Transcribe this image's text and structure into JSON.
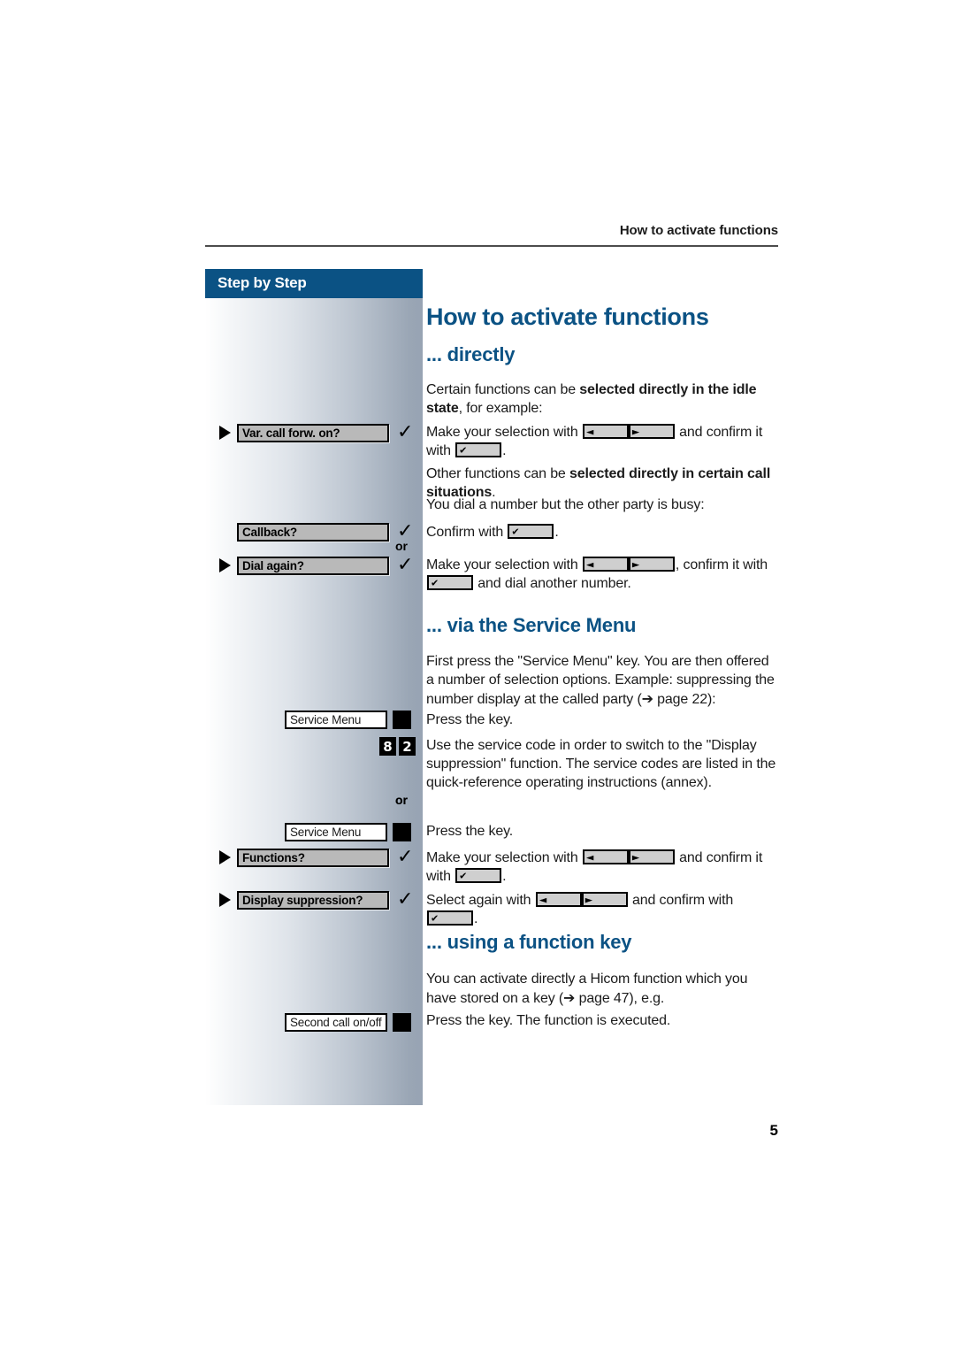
{
  "header": {
    "running_head": "How to activate functions"
  },
  "sidebar": {
    "tab_label": "Step by Step",
    "or_label": "or",
    "rows": [
      {
        "id": "var-call-forw-on",
        "type": "display",
        "arrow": true,
        "label": "Var. call forw. on?",
        "check": true
      },
      {
        "id": "callback",
        "type": "display",
        "arrow": false,
        "label": "Callback?",
        "check": true
      },
      {
        "id": "dial-again",
        "type": "display",
        "arrow": true,
        "label": "Dial again?",
        "check": true
      },
      {
        "id": "service-menu-1",
        "type": "key",
        "arrow": false,
        "label": "Service Menu",
        "check": false
      },
      {
        "id": "service-menu-2",
        "type": "key",
        "arrow": false,
        "label": "Service Menu",
        "check": false
      },
      {
        "id": "functions",
        "type": "display",
        "arrow": true,
        "label": "Functions?",
        "check": true
      },
      {
        "id": "display-suppression",
        "type": "display",
        "arrow": true,
        "label": "Display suppression?",
        "check": true
      },
      {
        "id": "second-call",
        "type": "key",
        "arrow": false,
        "label": "Second call on/off",
        "check": false
      }
    ],
    "service_code": {
      "digits": [
        "8",
        "2"
      ]
    }
  },
  "main": {
    "title": "How to activate functions",
    "section_directly": {
      "heading": "... directly",
      "p1_a": "Certain functions can be ",
      "p1_bold": "selected directly in the idle state",
      "p1_b": ", for example:",
      "p2_a": "Make your selection with ",
      "p2_b": " and confirm it with ",
      "p2_c": ".",
      "p3_a": "Other functions can be ",
      "p3_bold": "selected directly in certain call situations",
      "p3_b": ".",
      "p4": "You dial a number but the other party is busy:",
      "p5_a": "Confirm with ",
      "p5_b": ".",
      "p6_a": "Make your selection with ",
      "p6_b": ", confirm it with ",
      "p6_c": " and dial another number."
    },
    "section_service_menu": {
      "heading": "... via the Service Menu",
      "p1_a": "First press the \"Service Menu\" key. You are then offered a number of selection options. Example: suppressing the number display at the called party (",
      "p1_arrow": "➔",
      "p1_b": " page 22):",
      "p2": "Press the key.",
      "p3": "Use the service code in order to switch to the \"Display suppression\" function. The service codes are listed in the quick-reference operating instructions (annex).",
      "or_label": "or",
      "p4": "Press the key.",
      "p5_a": "Make your selection with ",
      "p5_b": " and confirm it with ",
      "p5_c": ".",
      "p6_a": "Select again with ",
      "p6_b": " and confirm with ",
      "p6_c": "."
    },
    "section_function_key": {
      "heading": "... using a function key",
      "p1_a": "You can activate directly a Hicom function which you have stored on a key (",
      "p1_arrow": "➔",
      "p1_b": " page 47), e.g.",
      "p2": "Press the key. The function is executed."
    }
  },
  "icons": {
    "left_arrow": "◄",
    "right_arrow": "►",
    "check": "✔",
    "check_big": "✓"
  },
  "footer": {
    "page_number": "5"
  },
  "colors": {
    "brand_blue": "#0b5284",
    "sidebar_end": "#97a3b3",
    "text": "#1b1b1b"
  }
}
